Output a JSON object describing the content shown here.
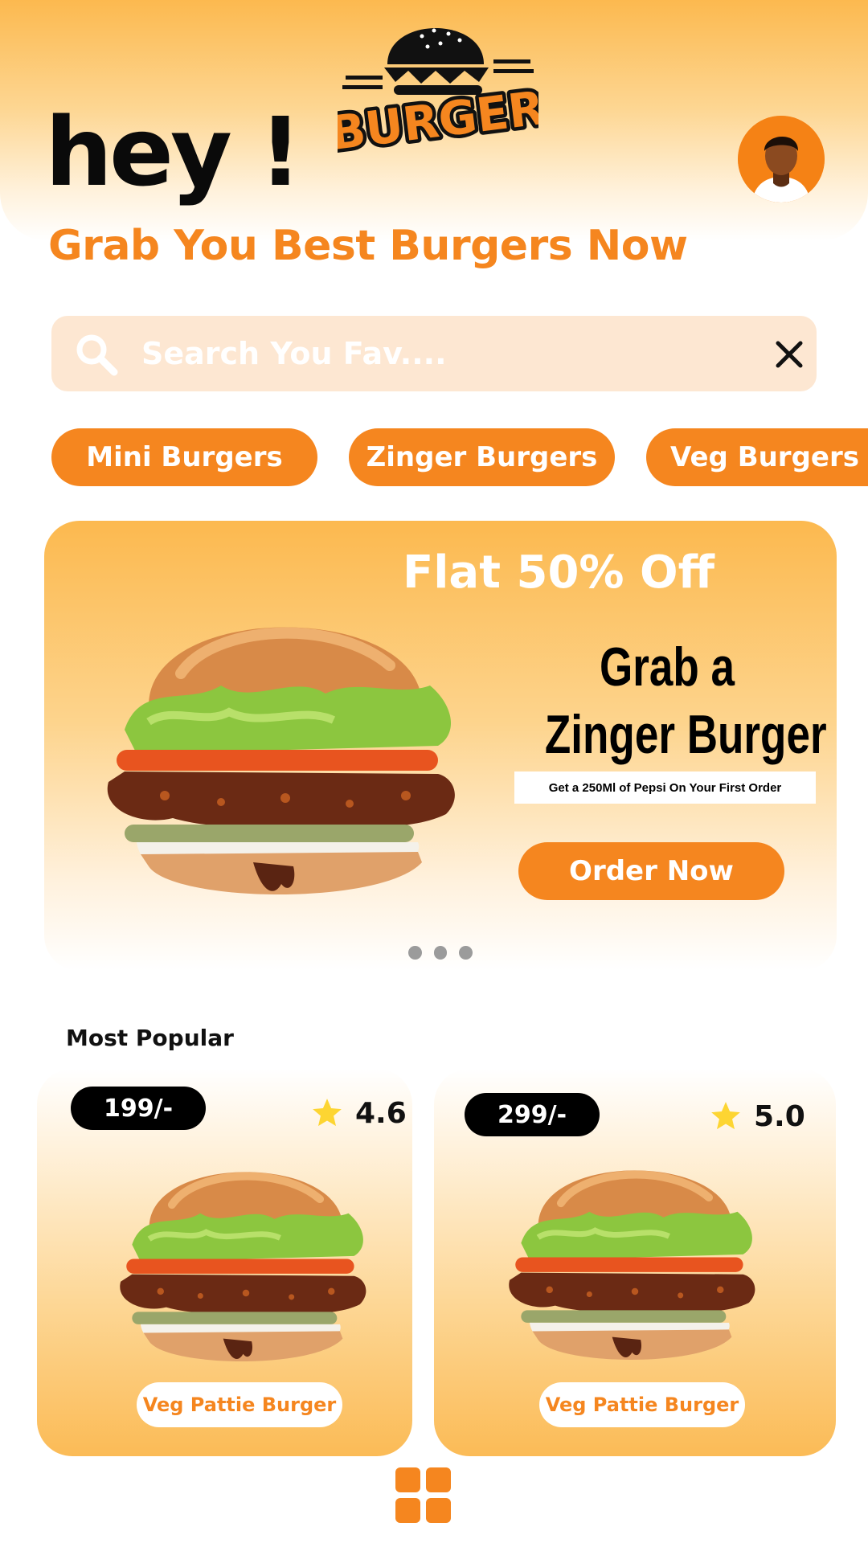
{
  "header": {
    "logo_text": "BURGER",
    "greeting": "hey !",
    "tagline": "Grab You Best Burgers Now"
  },
  "search": {
    "placeholder": "Search You Fav....",
    "value": ""
  },
  "categories": [
    {
      "label": "Mini Burgers"
    },
    {
      "label": "Zinger Burgers"
    },
    {
      "label": "Veg Burgers"
    }
  ],
  "promo": {
    "offer": "Flat 50% Off",
    "headline_line1": "Grab a",
    "headline_line2": "Zinger Burger",
    "note": "Get a 250Ml of Pepsi On Your First Order",
    "button_label": "Order Now",
    "carousel_slides": 3
  },
  "popular": {
    "title": "Most Popular",
    "items": [
      {
        "price": "199/-",
        "rating": "4.6",
        "name": "Veg Pattie Burger"
      },
      {
        "price": "299/-",
        "rating": "5.0",
        "name": "Veg Pattie Burger"
      }
    ]
  },
  "icons": {
    "search": "search-icon",
    "close": "close-icon",
    "star": "star-icon",
    "menu": "grid-menu-icon"
  },
  "colors": {
    "accent": "#f5861f",
    "gradient_top": "#fcb94f",
    "search_bg": "#fde7d2",
    "star": "#fdd532"
  }
}
